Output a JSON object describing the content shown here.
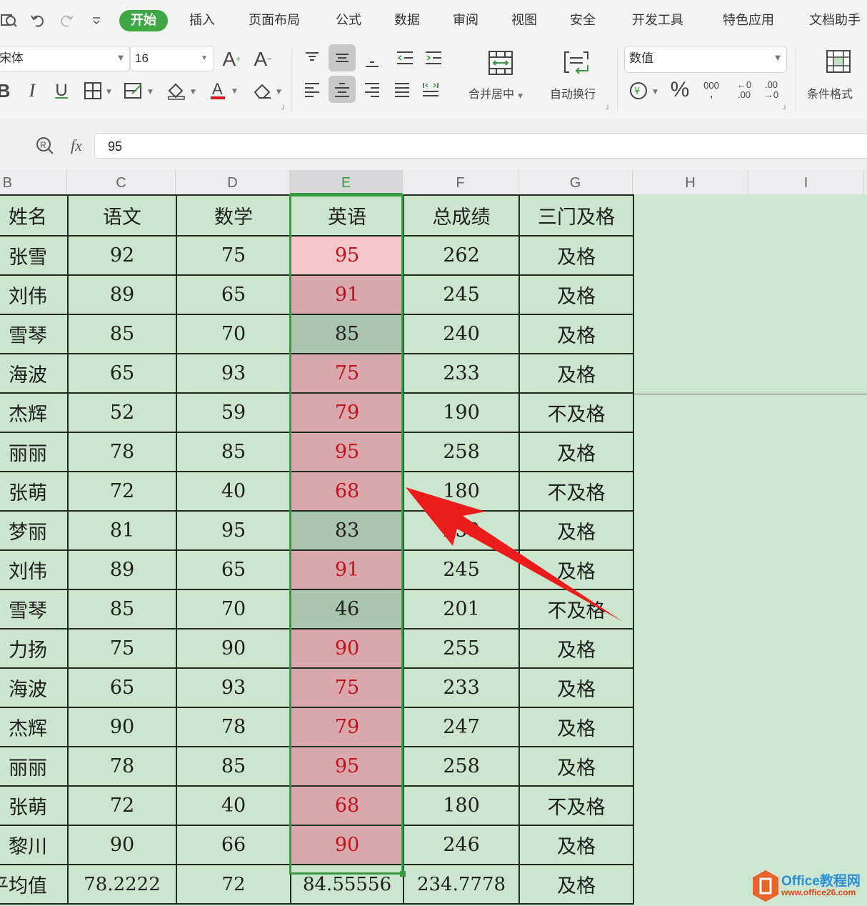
{
  "quick_access": {
    "icons": [
      "print-preview-icon",
      "undo-icon",
      "redo-icon",
      "customize-dropdown-icon"
    ]
  },
  "tabs": [
    {
      "label": "开始",
      "active": true
    },
    {
      "label": "插入"
    },
    {
      "label": "页面布局"
    },
    {
      "label": "公式"
    },
    {
      "label": "数据"
    },
    {
      "label": "审阅"
    },
    {
      "label": "视图"
    },
    {
      "label": "安全"
    },
    {
      "label": "开发工具"
    },
    {
      "label": "特色应用"
    },
    {
      "label": "文档助手"
    }
  ],
  "ribbon": {
    "font_name": "宋体",
    "font_size": "16",
    "bold": "B",
    "italic": "I",
    "underline": "U",
    "grow_font": "A",
    "shrink_font": "A",
    "merge_center_label": "合并居中",
    "wrap_text_label": "自动换行",
    "number_format": "数值",
    "percent": "%",
    "thousands": "000",
    "inc_decimal_top": "←0",
    "inc_decimal_bottom": ".00",
    "dec_decimal_top": ".00",
    "dec_decimal_bottom": "→0",
    "conditional_format_label": "条件格式",
    "colors": {
      "accent": "#3fa845",
      "font_color_bar": "#e0141c"
    }
  },
  "formula_bar": {
    "fx": "fx",
    "value": "95"
  },
  "columns": [
    "B",
    "C",
    "D",
    "E",
    "F",
    "G",
    "H",
    "I"
  ],
  "selected_column": "E",
  "sheet": {
    "headers": [
      "姓名",
      "语文",
      "数学",
      "英语",
      "总成绩",
      "三门及格"
    ],
    "rows": [
      {
        "name": "张雪",
        "chinese": "92",
        "math": "75",
        "english": "95",
        "total": "262",
        "pass": "及格",
        "eng_style": "bg-light"
      },
      {
        "name": "刘伟",
        "chinese": "89",
        "math": "65",
        "english": "91",
        "total": "245",
        "pass": "及格",
        "eng_style": "bg-pink"
      },
      {
        "name": "雪琴",
        "chinese": "85",
        "math": "70",
        "english": "85",
        "total": "240",
        "pass": "及格",
        "eng_style": "bg-grey"
      },
      {
        "name": "海波",
        "chinese": "65",
        "math": "93",
        "english": "75",
        "total": "233",
        "pass": "及格",
        "eng_style": "bg-pink"
      },
      {
        "name": "杰辉",
        "chinese": "52",
        "math": "59",
        "english": "79",
        "total": "190",
        "pass": "不及格",
        "eng_style": "bg-pink"
      },
      {
        "name": "丽丽",
        "chinese": "78",
        "math": "85",
        "english": "95",
        "total": "258",
        "pass": "及格",
        "eng_style": "bg-pink"
      },
      {
        "name": "张萌",
        "chinese": "72",
        "math": "40",
        "english": "68",
        "total": "180",
        "pass": "不及格",
        "eng_style": "bg-pink"
      },
      {
        "name": "梦丽",
        "chinese": "81",
        "math": "95",
        "english": "83",
        "total": "259",
        "pass": "及格",
        "eng_style": "bg-grey"
      },
      {
        "name": "刘伟",
        "chinese": "89",
        "math": "65",
        "english": "91",
        "total": "245",
        "pass": "及格",
        "eng_style": "bg-pink"
      },
      {
        "name": "雪琴",
        "chinese": "85",
        "math": "70",
        "english": "46",
        "total": "201",
        "pass": "不及格",
        "eng_style": "bg-grey"
      },
      {
        "name": "力扬",
        "chinese": "75",
        "math": "90",
        "english": "90",
        "total": "255",
        "pass": "及格",
        "eng_style": "bg-pink"
      },
      {
        "name": "海波",
        "chinese": "65",
        "math": "93",
        "english": "75",
        "total": "233",
        "pass": "及格",
        "eng_style": "bg-pink"
      },
      {
        "name": "杰辉",
        "chinese": "90",
        "math": "78",
        "english": "79",
        "total": "247",
        "pass": "及格",
        "eng_style": "bg-pink"
      },
      {
        "name": "丽丽",
        "chinese": "78",
        "math": "85",
        "english": "95",
        "total": "258",
        "pass": "及格",
        "eng_style": "bg-pink"
      },
      {
        "name": "张萌",
        "chinese": "72",
        "math": "40",
        "english": "68",
        "total": "180",
        "pass": "不及格",
        "eng_style": "bg-pink"
      },
      {
        "name": "黎川",
        "chinese": "90",
        "math": "66",
        "english": "90",
        "total": "246",
        "pass": "及格",
        "eng_style": "bg-pink"
      }
    ],
    "average_row": {
      "name": "平均值",
      "chinese": "78.2222",
      "math": "72",
      "english": "84.55556",
      "total": "234.7778",
      "pass": "及格"
    }
  },
  "watermark": {
    "title": "Office教程网",
    "url": "www.office26.com"
  }
}
